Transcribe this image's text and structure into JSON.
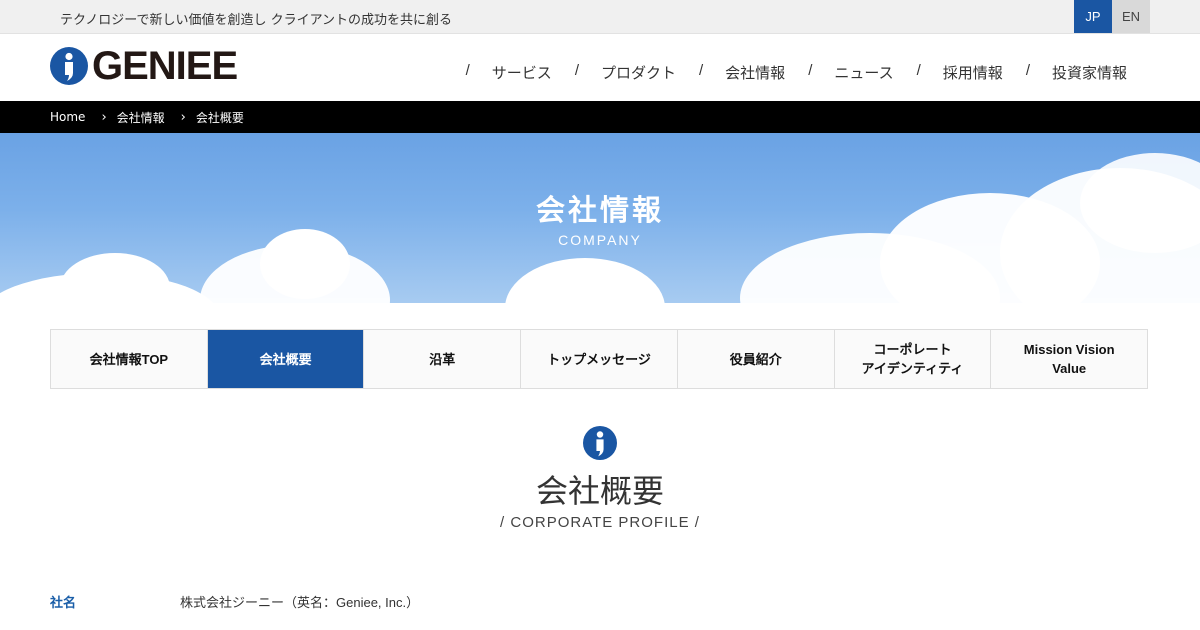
{
  "topbar": {
    "tagline": "テクノロジーで新しい価値を創造し クライアントの成功を共に創る",
    "lang_jp": "JP",
    "lang_en": "EN"
  },
  "header": {
    "logo_text": "GENIEE",
    "nav": [
      {
        "sep": "/",
        "label": "サービス"
      },
      {
        "sep": "/",
        "label": "プロダクト"
      },
      {
        "sep": "/",
        "label": "会社情報"
      },
      {
        "sep": "/",
        "label": "ニュース"
      },
      {
        "sep": "/",
        "label": "採用情報"
      },
      {
        "sep": "/",
        "label": "投資家情報"
      }
    ]
  },
  "breadcrumb": [
    "Home",
    "会社情報",
    "会社概要"
  ],
  "hero": {
    "title": "会社情報",
    "subtitle": "COMPANY"
  },
  "tabs": [
    {
      "label": "会社情報TOP"
    },
    {
      "label": "会社概要"
    },
    {
      "label": "沿革"
    },
    {
      "label": "トップメッセージ"
    },
    {
      "label": "役員紹介"
    },
    {
      "label": "コーポレート\nアイデンティティ"
    },
    {
      "label": "Mission Vision\nValue"
    }
  ],
  "active_tab": "会社概要",
  "section": {
    "title": "会社概要",
    "subtitle": "/ CORPORATE PROFILE /"
  },
  "profile": [
    {
      "label": "社名",
      "value": "株式会社ジーニー（英名：Geniee, Inc.）"
    }
  ],
  "colors": {
    "brand": "#1a56a3",
    "label_blue": "#1a5ea8"
  }
}
